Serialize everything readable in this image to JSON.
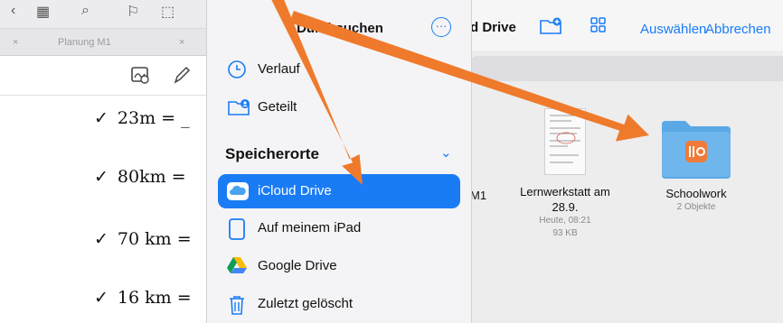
{
  "note_app": {
    "tab_label": "Planung M1",
    "lines": [
      {
        "check": "✓",
        "text": "23m = _"
      },
      {
        "check": "✓",
        "text": "80km ="
      },
      {
        "check": "✓",
        "text": "70 km ="
      },
      {
        "check": "✓",
        "text": "16 km ="
      }
    ]
  },
  "popover": {
    "title": "Durchsuchen",
    "more_icon": "ellipsis-circle-icon",
    "items_top": [
      {
        "label": "Verlauf",
        "icon": "clock-icon"
      },
      {
        "label": "Geteilt",
        "icon": "shared-folder-icon"
      }
    ],
    "section_title": "Speicherorte",
    "locations": [
      {
        "label": "iCloud Drive",
        "icon": "icloud-icon",
        "selected": true
      },
      {
        "label": "Auf meinem iPad",
        "icon": "ipad-icon",
        "selected": false
      },
      {
        "label": "Google Drive",
        "icon": "google-drive-icon",
        "selected": false
      },
      {
        "label": "Zuletzt gelöscht",
        "icon": "trash-icon",
        "selected": false
      }
    ]
  },
  "files_app": {
    "title": "d Drive",
    "select_label": "Auswählen",
    "cancel_label": "Abbrechen",
    "partial_label": "M1",
    "items": [
      {
        "name_line1": "Lernwerkstatt am",
        "name_line2": "28.9.",
        "date": "Heute, 08:21",
        "size": "93 KB"
      },
      {
        "name_line1": "Schoolwork",
        "meta": "2 Objekte"
      }
    ]
  },
  "colors": {
    "accent": "#1a7cf5",
    "arrow": "#ef7a2b",
    "folder": "#5aa9e6"
  }
}
